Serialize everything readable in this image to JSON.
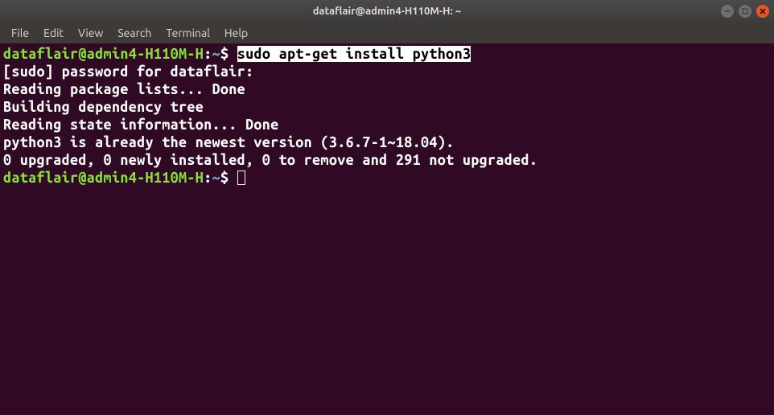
{
  "window": {
    "title": "dataflair@admin4-H110M-H: ~"
  },
  "menubar": {
    "items": [
      "File",
      "Edit",
      "View",
      "Search",
      "Terminal",
      "Help"
    ]
  },
  "terminal": {
    "prompt": {
      "userhost": "dataflair@admin4-H110M-H",
      "colon": ":",
      "path": "~",
      "dollar": "$"
    },
    "command1": "sudo apt-get install python3",
    "output": [
      "[sudo] password for dataflair:",
      "Reading package lists... Done",
      "Building dependency tree",
      "Reading state information... Done",
      "python3 is already the newest version (3.6.7-1~18.04).",
      "0 upgraded, 0 newly installed, 0 to remove and 291 not upgraded."
    ]
  }
}
